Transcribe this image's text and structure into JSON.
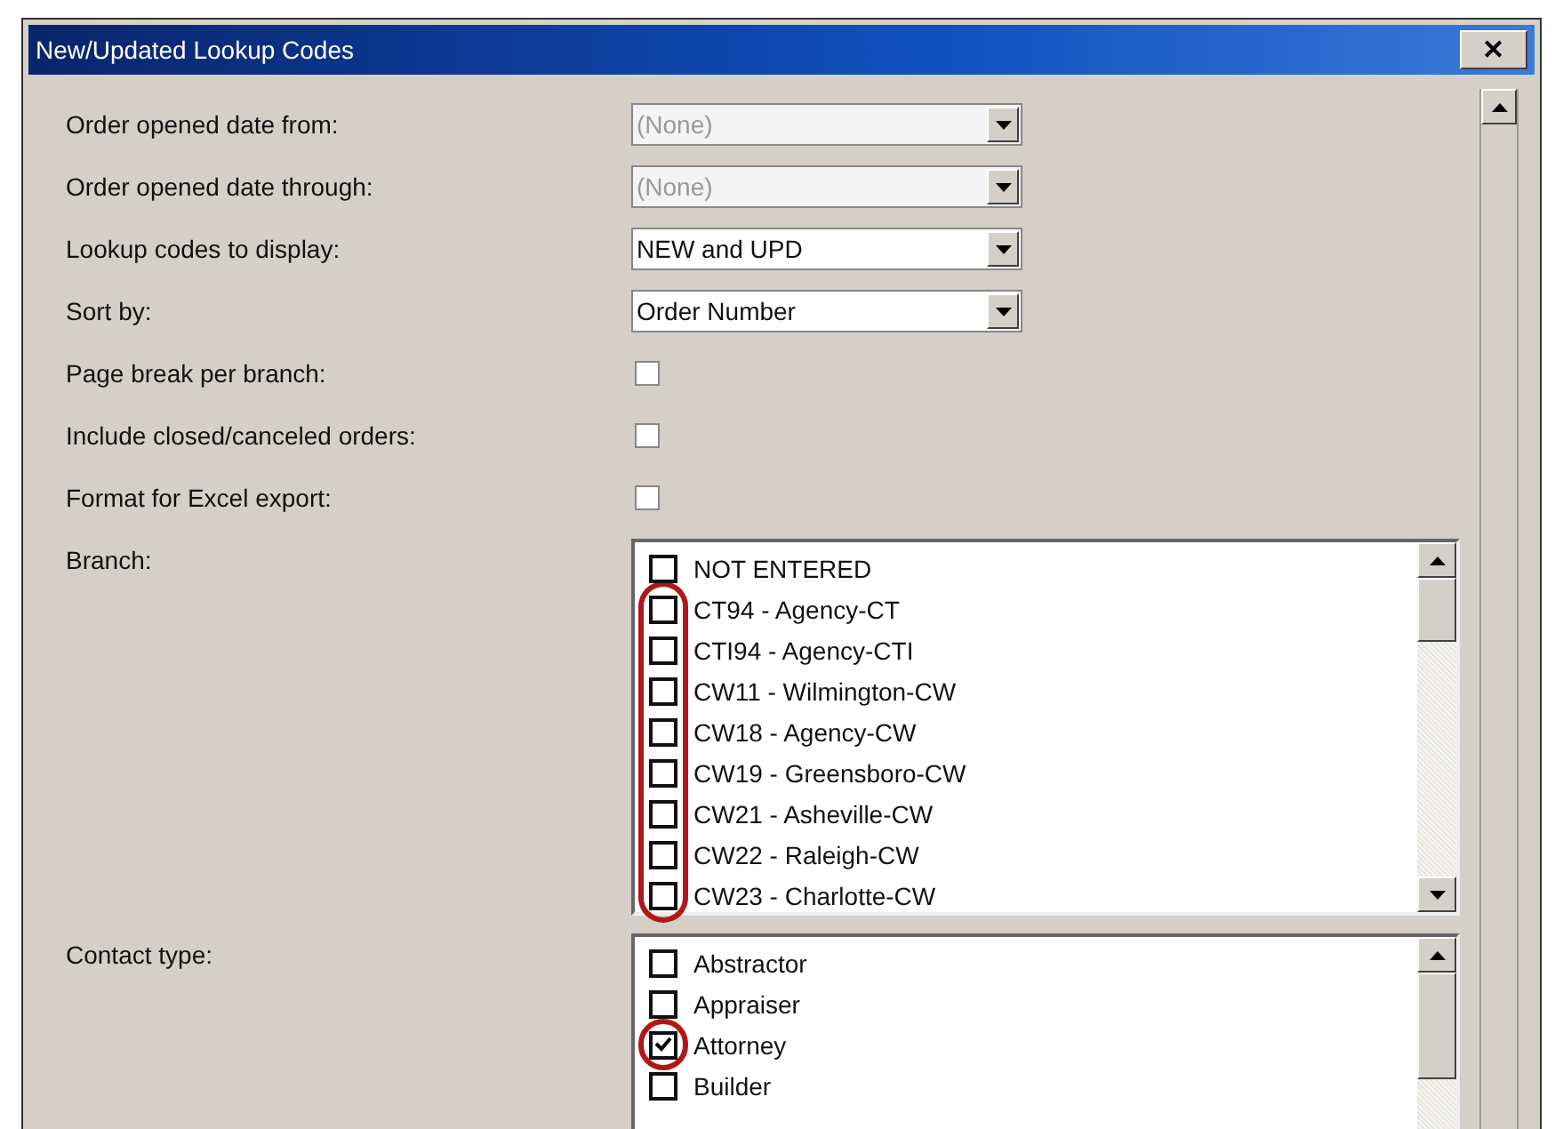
{
  "window": {
    "title": "New/Updated Lookup Codes",
    "close": "✕"
  },
  "fields": [
    {
      "kind": "combo",
      "label": "Order opened date from:",
      "value": "(None)",
      "disabled": true
    },
    {
      "kind": "combo",
      "label": "Order opened date through:",
      "value": "(None)",
      "disabled": true
    },
    {
      "kind": "combo",
      "label": "Lookup codes to display:",
      "value": "NEW and UPD",
      "disabled": false
    },
    {
      "kind": "combo",
      "label": "Sort by:",
      "value": "Order Number",
      "disabled": false
    },
    {
      "kind": "check",
      "label": "Page break per branch:",
      "checked": false
    },
    {
      "kind": "check",
      "label": "Include closed/canceled orders:",
      "checked": false
    },
    {
      "kind": "check",
      "label": "Format for Excel export:",
      "checked": false
    },
    {
      "kind": "list",
      "label": "Branch:",
      "items": [
        {
          "label": "NOT ENTERED",
          "checked": false,
          "circled": false
        },
        {
          "label": "CT94 - Agency-CT",
          "checked": false,
          "circled": true
        },
        {
          "label": "CTI94 - Agency-CTI",
          "checked": false,
          "circled": true
        },
        {
          "label": "CW11 - Wilmington-CW",
          "checked": false,
          "circled": true
        },
        {
          "label": "CW18 - Agency-CW",
          "checked": false,
          "circled": true
        },
        {
          "label": "CW19 - Greensboro-CW",
          "checked": false,
          "circled": true
        },
        {
          "label": "CW21 - Asheville-CW",
          "checked": false,
          "circled": true
        },
        {
          "label": "CW22 - Raleigh-CW",
          "checked": false,
          "circled": true
        },
        {
          "label": "CW23 - Charlotte-CW",
          "checked": false,
          "circled": true
        }
      ]
    },
    {
      "kind": "list",
      "label": "Contact type:",
      "items": [
        {
          "label": "Abstractor",
          "checked": false,
          "circled": false
        },
        {
          "label": "Appraiser",
          "checked": false,
          "circled": false
        },
        {
          "label": "Attorney",
          "checked": true,
          "circled": true
        },
        {
          "label": "Builder",
          "checked": false,
          "circled": false
        }
      ]
    }
  ]
}
